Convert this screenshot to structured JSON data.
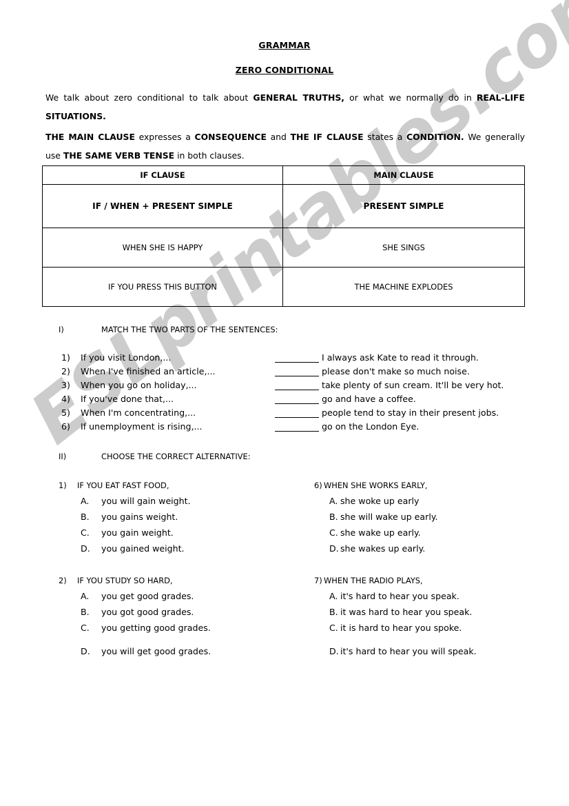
{
  "document": {
    "title": "GRAMMAR",
    "subtitle": "ZERO CONDITIONAL",
    "watermark": "ESLprintables.com",
    "watermark_color": "#cccccc"
  },
  "intro": {
    "p1_part1": "We talk about zero conditional to talk about ",
    "p1_bold1": "GENERAL TRUTHS,",
    "p1_part2": " or what we normally do in ",
    "p1_bold2": "REAL-LIFE SITUATIONS.",
    "p2_bold1": "THE MAIN CLAUSE",
    "p2_part1": " expresses a ",
    "p2_bold2": "CONSEQUENCE",
    "p2_part2": " and  ",
    "p2_bold3": "THE IF CLAUSE",
    "p2_part3": " states a ",
    "p2_bold4": "CONDITION.",
    "p2_part4": " We generally use ",
    "p2_bold5": "THE SAME VERB TENSE",
    "p2_part5": " in both clauses."
  },
  "table": {
    "headers": [
      "IF CLAUSE",
      "MAIN CLAUSE"
    ],
    "rows": [
      {
        "if_clause": "IF / WHEN + PRESENT SIMPLE",
        "main_clause": "PRESENT SIMPLE"
      },
      {
        "if_clause": "WHEN SHE IS HAPPY",
        "main_clause": "SHE SINGS"
      },
      {
        "if_clause": "IF YOU PRESS THIS BUTTON",
        "main_clause": "THE MACHINE EXPLODES"
      }
    ]
  },
  "exercise1": {
    "number": "I)",
    "instruction": "MATCH THE TWO PARTS OF THE SENTENCES:",
    "items": [
      {
        "num": "1)",
        "left": "If you visit London,...",
        "right": "I always ask Kate to read it through."
      },
      {
        "num": "2)",
        "left": "When I've finished an article,...",
        "right": "please don't make so much noise."
      },
      {
        "num": "3)",
        "left": "When you go on holiday,...",
        "right": "take plenty of sun cream. It'll be very hot."
      },
      {
        "num": "4)",
        "left": "If you've done that,...",
        "right": "go and have a coffee."
      },
      {
        "num": "5)",
        "left": "When I'm concentrating,...",
        "right": "people tend to stay in their present jobs."
      },
      {
        "num": "6)",
        "left": "If unemployment is rising,...",
        "right": "go on the London Eye."
      }
    ]
  },
  "exercise2": {
    "number": "II)",
    "instruction": "CHOOSE THE CORRECT ALTERNATIVE:",
    "questions_left": [
      {
        "num": "1)",
        "stem": "IF YOU EAT FAST FOOD,",
        "options": [
          {
            "letter": "A.",
            "text": "you will gain weight."
          },
          {
            "letter": "B.",
            "text": "you gains weight."
          },
          {
            "letter": "C.",
            "text": "you gain weight."
          },
          {
            "letter": "D.",
            "text": "you gained weight."
          }
        ]
      },
      {
        "num": "2)",
        "stem": "IF YOU STUDY SO HARD,",
        "options": [
          {
            "letter": "A.",
            "text": "you get good grades."
          },
          {
            "letter": "B.",
            "text": "you got good grades."
          },
          {
            "letter": "C.",
            "text": "you getting good grades."
          },
          {
            "letter": "D.",
            "text": "you will get good grades."
          }
        ]
      }
    ],
    "questions_right": [
      {
        "num": "6)",
        "stem": "WHEN SHE WORKS EARLY,",
        "options": [
          {
            "letter": "A.",
            "text": "she woke up early"
          },
          {
            "letter": "B.",
            "text": "she will wake up early."
          },
          {
            "letter": "C.",
            "text": "she wake up early."
          },
          {
            "letter": "D.",
            "text": "she wakes up early."
          }
        ]
      },
      {
        "num": "7)",
        "stem": "WHEN THE RADIO PLAYS,",
        "options": [
          {
            "letter": "A.",
            "text": "it's hard to hear you speak."
          },
          {
            "letter": "B.",
            "text": "it was hard to hear you speak."
          },
          {
            "letter": "C.",
            "text": "it is hard to hear you spoke."
          },
          {
            "letter": "D.",
            "text": "it's hard to hear you will speak."
          }
        ]
      }
    ]
  }
}
